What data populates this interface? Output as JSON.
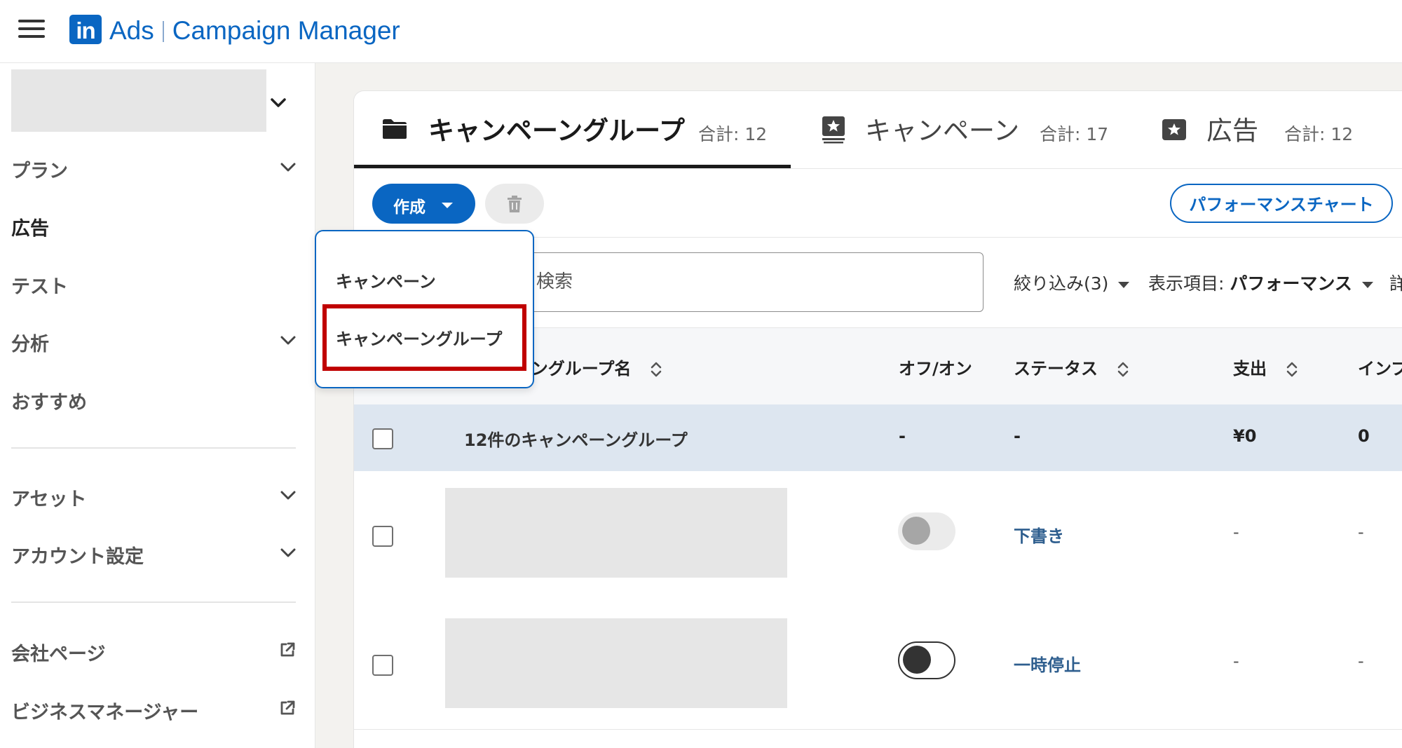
{
  "header": {
    "logo_text": "in",
    "product": "Ads",
    "app_title": "Campaign Manager"
  },
  "sidebar": {
    "items": [
      {
        "label": "プラン"
      },
      {
        "label": "広告"
      },
      {
        "label": "テスト"
      },
      {
        "label": "分析"
      },
      {
        "label": "おすすめ"
      },
      {
        "label": "アセット"
      },
      {
        "label": "アカウント設定"
      },
      {
        "label": "会社ページ"
      },
      {
        "label": "ビジネスマネージャー"
      }
    ]
  },
  "tabs": [
    {
      "label": "キャンペーングループ",
      "count": "合計: 12",
      "icon": "folder-icon"
    },
    {
      "label": "キャンペーン",
      "count": "合計: 17",
      "icon": "campaign-icon"
    },
    {
      "label": "広告",
      "count": "合計: 12",
      "icon": "ad-icon"
    }
  ],
  "toolbar": {
    "create_label": "作成",
    "performance_chart_label": "パフォーマンスチャート"
  },
  "search": {
    "placeholder": "検索"
  },
  "filters": {
    "filter_label": "絞り込み(3)",
    "display_label": "表示項目:",
    "display_value": "パフォーマンス",
    "cut_text": "詳"
  },
  "table": {
    "headers": {
      "name": "ーングループ名",
      "on_off": "オフ/オン",
      "status": "ステータス",
      "spend": "支出",
      "impressions": "インプ"
    },
    "summary": {
      "name": "12件のキャンペーングループ",
      "on_off": "-",
      "status": "-",
      "spend": "¥0",
      "impressions": "0"
    },
    "rows": [
      {
        "status": "下書き",
        "spend": "-",
        "impressions": "-"
      },
      {
        "status": "一時停止",
        "spend": "-",
        "impressions": "-"
      }
    ]
  },
  "create_menu": {
    "items": [
      "キャンペーン",
      "キャンペーングループ"
    ]
  },
  "colors": {
    "brand": "#0a66c2",
    "highlight": "#c00000",
    "summary_row": "#dde6f0",
    "status_link": "#2e5e8e"
  }
}
